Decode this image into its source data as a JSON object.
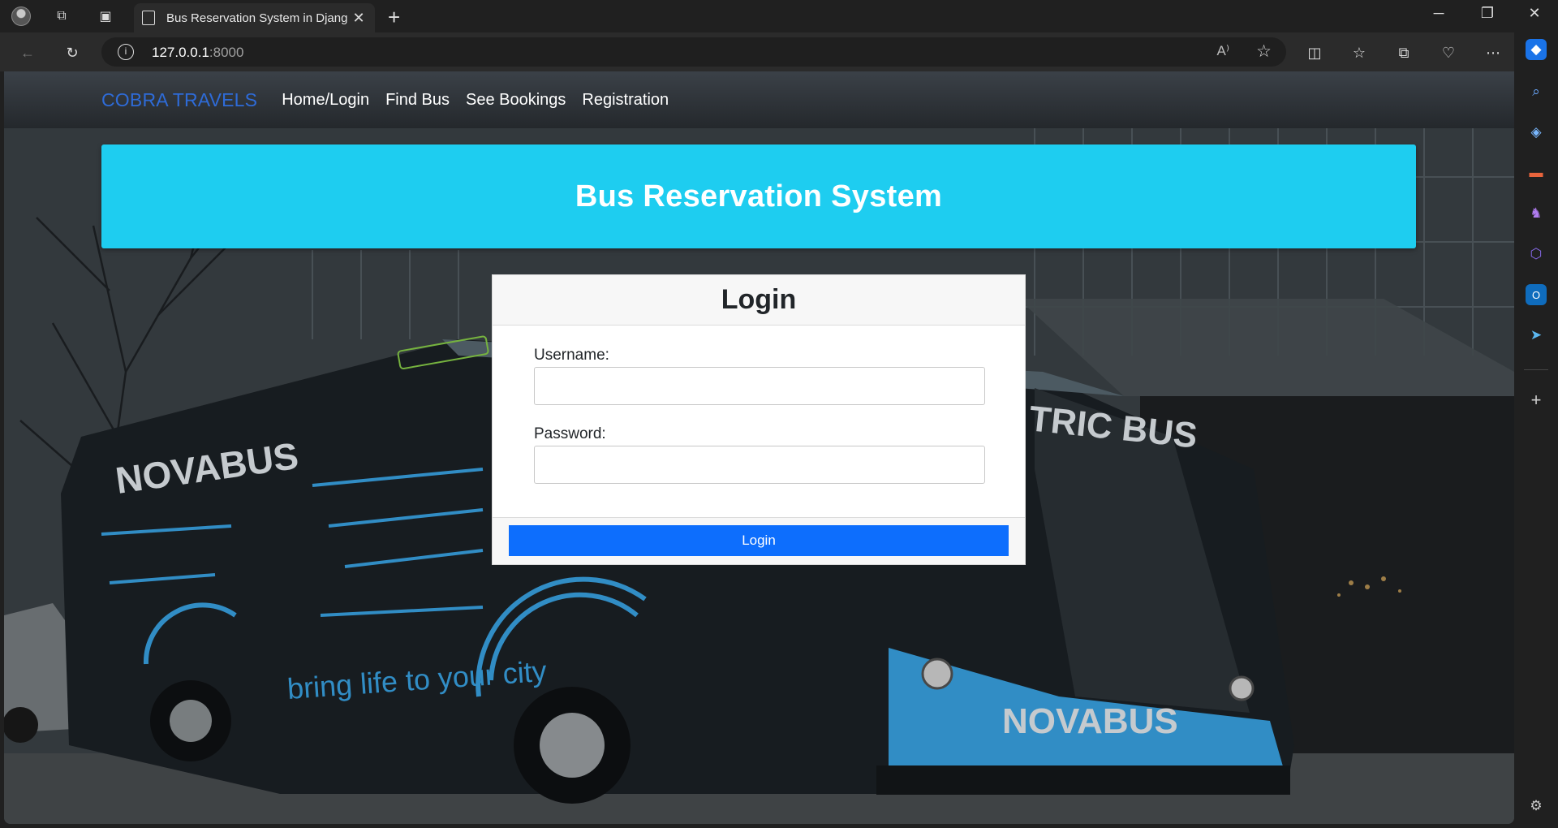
{
  "browser": {
    "tab_title": "Bus Reservation System in Djang",
    "url_host": "127.0.0.1",
    "url_port": ":8000",
    "read_aloud": "A⁾"
  },
  "site": {
    "brand": "COBRA TRAVELS",
    "nav": [
      "Home/Login",
      "Find Bus",
      "See Bookings",
      "Registration"
    ],
    "banner_title": "Bus Reservation System"
  },
  "login": {
    "title": "Login",
    "username_label": "Username:",
    "password_label": "Password:",
    "submit_label": "Login",
    "username_value": "",
    "password_value": ""
  },
  "hero_image": {
    "bus_brand": "NOVABUS",
    "bus_brand_front": "NOVABUS",
    "slogan": "bring life to your city",
    "destination_sign": "TRIC BUS"
  },
  "colors": {
    "banner": "#1ecdf0",
    "brand": "#2e6bd8",
    "button": "#0d6efd",
    "bus_body": "#3aa6e8"
  }
}
